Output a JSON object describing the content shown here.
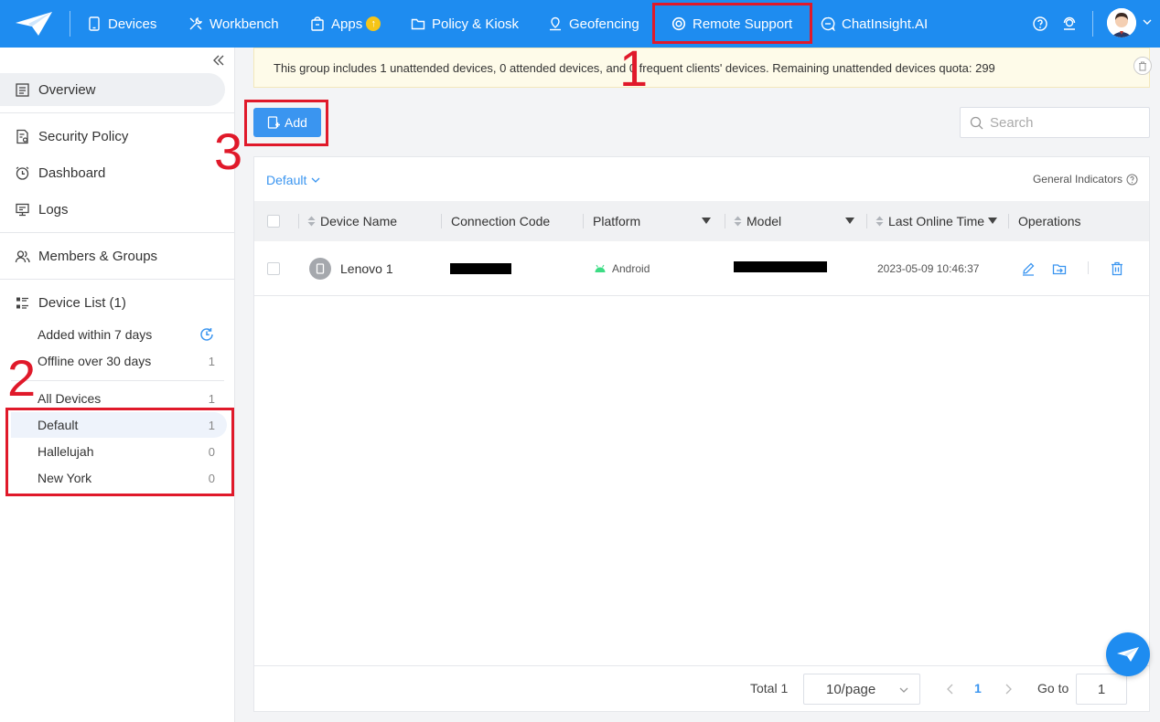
{
  "topnav": {
    "items": [
      {
        "label": "Devices",
        "icon": "tablet-icon"
      },
      {
        "label": "Workbench",
        "icon": "tools-icon"
      },
      {
        "label": "Apps",
        "icon": "app-bag-icon",
        "badge": "upgrade-arrow-icon"
      },
      {
        "label": "Policy & Kiosk",
        "icon": "folder-icon"
      },
      {
        "label": "Geofencing",
        "icon": "map-pin-icon"
      },
      {
        "label": "Remote Support",
        "icon": "lifebuoy-icon"
      },
      {
        "label": "ChatInsight.AI",
        "icon": "chat-ai-icon"
      }
    ],
    "accent": "#1e8cf0"
  },
  "annotations": {
    "one": "1",
    "two": "2",
    "three": "3",
    "color": "#e0192a"
  },
  "sidebar": {
    "overview": "Overview",
    "security_policy": "Security Policy",
    "dashboard": "Dashboard",
    "logs": "Logs",
    "members_groups": "Members & Groups",
    "device_list": "Device List (1)",
    "added_within": "Added within 7 days",
    "offline_over": "Offline over 30 days",
    "offline_count": "1",
    "groups": [
      {
        "label": "All Devices",
        "count": "1"
      },
      {
        "label": "Default",
        "count": "1"
      },
      {
        "label": "Hallelujah",
        "count": "0"
      },
      {
        "label": "New York",
        "count": "0"
      }
    ]
  },
  "banner": {
    "text": "This group includes 1 unattended devices, 0 attended devices, and 0 frequent clients' devices. Remaining unattended devices quota: 299"
  },
  "toolbar": {
    "add_label": "Add",
    "search_placeholder": "Search"
  },
  "table": {
    "group": "Default",
    "general_indicators": "General Indicators",
    "headers": {
      "device_name": "Device Name",
      "connection_code": "Connection Code",
      "platform": "Platform",
      "model": "Model",
      "last_online": "Last Online Time",
      "operations": "Operations"
    },
    "rows": [
      {
        "device_name": "Lenovo 1",
        "platform": "Android",
        "last_online": "2023-05-09 10:46:37"
      }
    ]
  },
  "pager": {
    "total": "Total 1",
    "page_size": "10/page",
    "current": "1",
    "goto_label": "Go to",
    "goto_value": "1"
  }
}
